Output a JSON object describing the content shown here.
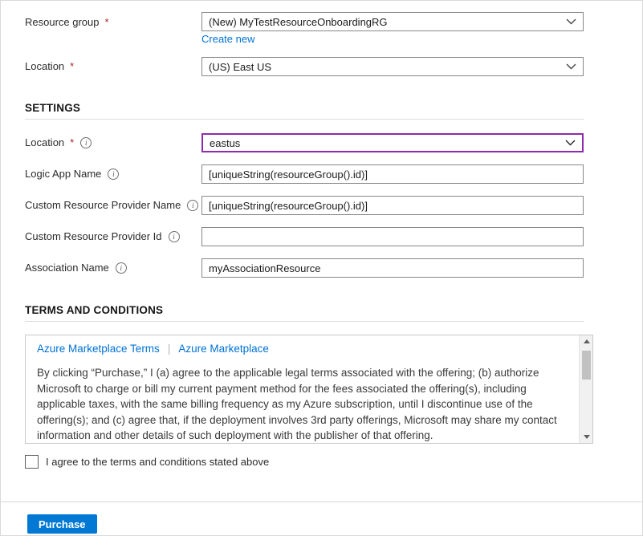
{
  "colors": {
    "accent_blue": "#0078d4",
    "link_blue": "#0072d4",
    "required_red": "#a4262c",
    "focus_purple": "#8f2bad"
  },
  "required_marker": "*",
  "icons": {
    "info": "i"
  },
  "basics": {
    "resource_group": {
      "label": "Resource group",
      "value": "(New) MyTestResourceOnboardingRG",
      "create_new_label": "Create new"
    },
    "location": {
      "label": "Location",
      "value": "(US) East US"
    }
  },
  "settings": {
    "heading": "SETTINGS",
    "fields": [
      {
        "label": "Location",
        "value": "eastus"
      },
      {
        "label": "Logic App Name",
        "value": "[uniqueString(resourceGroup().id)]"
      },
      {
        "label": "Custom Resource Provider Name",
        "value": "[uniqueString(resourceGroup().id)]"
      },
      {
        "label": "Custom Resource Provider Id",
        "value": ""
      },
      {
        "label": "Association Name",
        "value": "myAssociationResource"
      }
    ]
  },
  "terms": {
    "heading": "TERMS AND CONDITIONS",
    "links": [
      "Azure Marketplace Terms",
      "Azure Marketplace"
    ],
    "links_separator": "|",
    "body": "By clicking “Purchase,” I (a) agree to the applicable legal terms associated with the offering; (b) authorize Microsoft to charge or bill my current payment method for the fees associated the offering(s), including applicable taxes, with the same billing frequency as my Azure subscription, until I discontinue use of the offering(s); and (c) agree that, if the deployment involves 3rd party offerings, Microsoft may share my contact information and other details of such deployment with the publisher of that offering.",
    "checkbox_label": "I agree to the terms and conditions stated above"
  },
  "actions": {
    "purchase_label": "Purchase"
  }
}
